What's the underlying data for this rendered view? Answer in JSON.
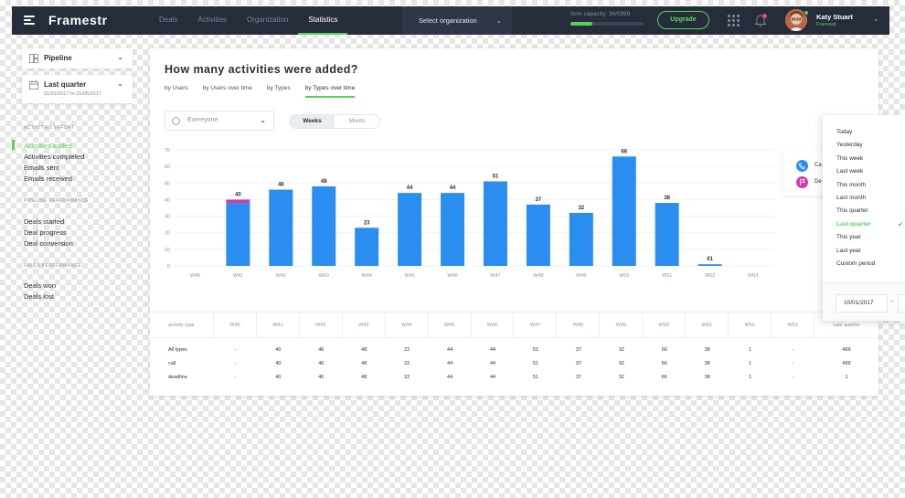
{
  "app": {
    "brand": "Framestr",
    "nav": [
      "Deals",
      "Activities",
      "Organization",
      "Statistics"
    ],
    "nav_active": 3,
    "org_select": "Select organization",
    "capacity_label": "form capacity: 36/0999",
    "capacity_fraction": 0.3,
    "upgrade": "Upgrade",
    "user_name": "Katy Stuart",
    "user_company": "Framestr"
  },
  "sidebar": {
    "pipeline": "Pipeline",
    "period_label": "Last quarter",
    "period_range": "01/01/2017 to 31/05/2017",
    "sections": [
      {
        "title": "ACTIVITIES EFFORT",
        "links": [
          "Activities added",
          "Activities completed",
          "Emails sent",
          "Emails received"
        ]
      },
      {
        "title": "PIPELINE PERFORMANCE",
        "links": [
          "Deals started",
          "Deal progress",
          "Deal conversion"
        ]
      },
      {
        "title": "SALES PERFORMANCE",
        "links": [
          "Deals won",
          "Deals lost"
        ]
      }
    ]
  },
  "main": {
    "title": "How many activities were added?",
    "tabs": [
      "by Users",
      "by Users over time",
      "by Types",
      "by Types over time"
    ],
    "tab_active": 3,
    "filter": "Evereyone",
    "segments": [
      "Weeks",
      "Monts"
    ],
    "segment_active": 0,
    "legend": [
      {
        "label": "Ca",
        "color": "#2a8ef0"
      },
      {
        "label": "De",
        "color": "#d63aa8"
      }
    ]
  },
  "chart_data": {
    "type": "bar",
    "categories": [
      "W40",
      "W41",
      "W42",
      "W43",
      "W44",
      "W45",
      "W46",
      "W47",
      "W48",
      "W49",
      "W50",
      "W51",
      "W52",
      "W53"
    ],
    "series": [
      {
        "name": "Call",
        "values": [
          0,
          38,
          46,
          48,
          23,
          44,
          44,
          51,
          37,
          32,
          66,
          38,
          1,
          0
        ]
      },
      {
        "name": "Deadline",
        "values": [
          0,
          2,
          0,
          0,
          0,
          0,
          0,
          0,
          0,
          0,
          0,
          0,
          0,
          0
        ]
      }
    ],
    "data_labels": [
      "",
      "40",
      "46",
      "48",
      "23",
      "44",
      "44",
      "51",
      "37",
      "32",
      "66",
      "38",
      "01",
      ""
    ],
    "ylim": [
      0,
      70
    ],
    "yticks": [
      0,
      10,
      20,
      30,
      40,
      50,
      60,
      70
    ],
    "colors": {
      "Call": "#2a8ef0",
      "Deadline": "#d63aa8"
    },
    "grid": true
  },
  "table": {
    "headers": [
      "activity type",
      "W40",
      "W41",
      "W42",
      "W43",
      "W44",
      "W45",
      "W46",
      "W47",
      "W48",
      "W49",
      "W50",
      "W51",
      "W52",
      "W53",
      "Last quarter"
    ],
    "rows": [
      [
        "All types",
        "-",
        "40",
        "46",
        "48",
        "22",
        "44",
        "44",
        "51",
        "37",
        "32",
        "66",
        "38",
        "1",
        "-",
        "469"
      ],
      [
        "call",
        "-",
        "40",
        "46",
        "48",
        "22",
        "44",
        "44",
        "51",
        "37",
        "32",
        "66",
        "38",
        "1",
        "-",
        "469"
      ],
      [
        "deadline",
        "-",
        "40",
        "46",
        "48",
        "22",
        "44",
        "44",
        "51",
        "37",
        "32",
        "66",
        "38",
        "1",
        "-",
        "1"
      ]
    ]
  },
  "dropdown": {
    "items": [
      "Today",
      "Yesterday",
      "This week",
      "Last week",
      "This month",
      "Last month",
      "This quarter",
      "Last quarter",
      "This year",
      "Last year",
      "Custom period"
    ],
    "active": 7,
    "date_from": "10/01/2017",
    "date_sep": "–"
  }
}
